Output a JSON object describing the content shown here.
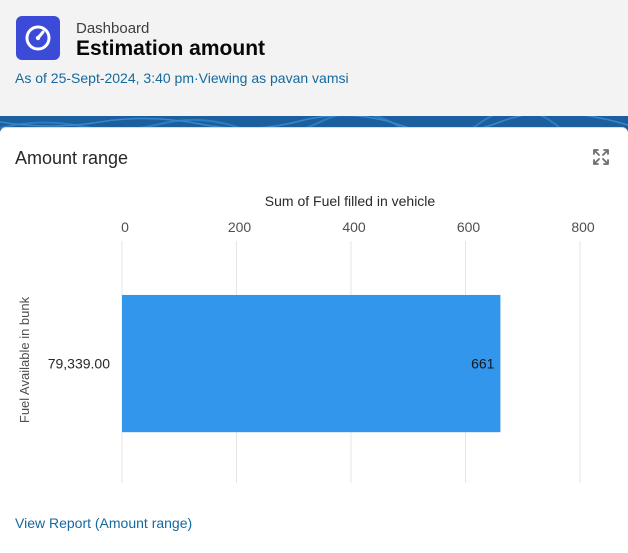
{
  "header": {
    "eyebrow": "Dashboard",
    "title": "Estimation amount",
    "as_of": "As of 25-Sept-2024, 3:40 pm",
    "separator": "·",
    "viewing_as": "Viewing as pavan vamsi",
    "icon": "dashboard-gauge-icon",
    "icon_color": "#3b4bd8"
  },
  "card": {
    "title": "Amount range",
    "expand_icon": "expand-icon",
    "view_report_label": "View Report (Amount range)"
  },
  "chart_data": {
    "type": "bar",
    "orientation": "horizontal",
    "title": "",
    "xlabel": "Sum of Fuel filled in vehicle",
    "ylabel": "Fuel Available in bunk",
    "categories": [
      "79,339.00"
    ],
    "values": [
      661
    ],
    "data_labels": [
      "661"
    ],
    "xlim": [
      0,
      800
    ],
    "xticks": [
      0,
      200,
      400,
      600,
      800
    ],
    "x_axis_position": "top",
    "grid": true,
    "bar_color": "#3296ed"
  }
}
